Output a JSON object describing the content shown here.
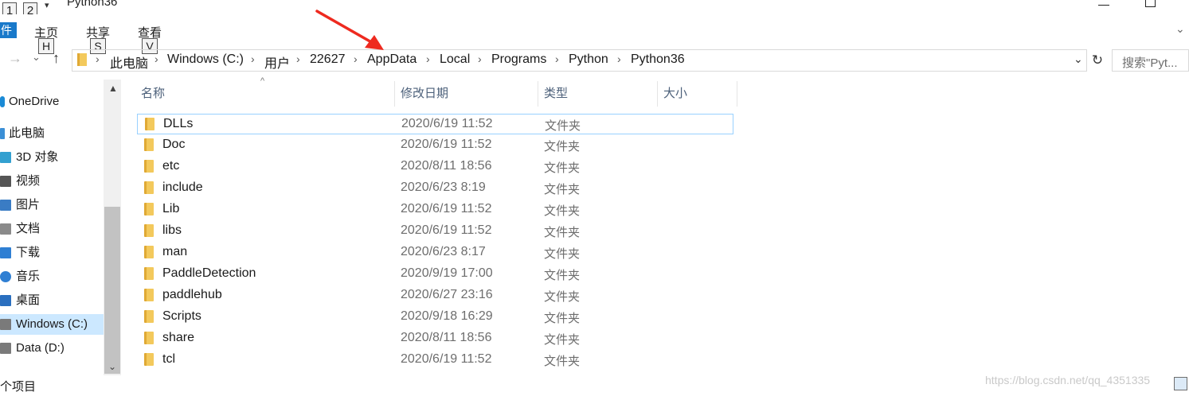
{
  "window": {
    "title": "Python36"
  },
  "quick_access": {
    "badges": [
      "1",
      "2"
    ],
    "dropdown_icon": "caret-down-icon"
  },
  "ribbon": {
    "file_tab_label": "件",
    "tabs": [
      {
        "label": "主页",
        "keytip": "H"
      },
      {
        "label": "共享",
        "keytip": "S"
      },
      {
        "label": "查看",
        "keytip": "V"
      }
    ]
  },
  "address": {
    "breadcrumbs": [
      "此电脑",
      "Windows (C:)",
      "用户",
      "22627",
      "AppData",
      "Local",
      "Programs",
      "Python",
      "Python36"
    ],
    "separator": "›"
  },
  "search": {
    "placeholder": "搜索\"Pyt..."
  },
  "nav_pane": {
    "items": [
      {
        "label": "OneDrive",
        "icon": "cloud-icon",
        "color": "#1a8ad6"
      },
      {
        "label": "此电脑",
        "icon": "computer-icon",
        "color": "#3b8fd6"
      },
      {
        "label": "3D 对象",
        "icon": "cube-icon",
        "color": "#33a0d0"
      },
      {
        "label": "视频",
        "icon": "film-icon",
        "color": "#555555"
      },
      {
        "label": "图片",
        "icon": "picture-icon",
        "color": "#3a7cc4"
      },
      {
        "label": "文档",
        "icon": "document-icon",
        "color": "#8a8a8a"
      },
      {
        "label": "下载",
        "icon": "download-arrow-icon",
        "color": "#2f7fd3"
      },
      {
        "label": "音乐",
        "icon": "music-note-icon",
        "color": "#2f7fd3"
      },
      {
        "label": "桌面",
        "icon": "desktop-icon",
        "color": "#2a6fbf"
      },
      {
        "label": "Windows (C:)",
        "icon": "drive-icon",
        "color": "#7a7a7a",
        "selected": true
      },
      {
        "label": "Data (D:)",
        "icon": "drive-icon",
        "color": "#7a7a7a"
      }
    ]
  },
  "columns": {
    "name": "名称",
    "date": "修改日期",
    "type": "类型",
    "size": "大小"
  },
  "files": [
    {
      "name": "DLLs",
      "date": "2020/6/19 11:52",
      "type": "文件夹"
    },
    {
      "name": "Doc",
      "date": "2020/6/19 11:52",
      "type": "文件夹"
    },
    {
      "name": "etc",
      "date": "2020/8/11 18:56",
      "type": "文件夹"
    },
    {
      "name": "include",
      "date": "2020/6/23 8:19",
      "type": "文件夹"
    },
    {
      "name": "Lib",
      "date": "2020/6/19 11:52",
      "type": "文件夹"
    },
    {
      "name": "libs",
      "date": "2020/6/19 11:52",
      "type": "文件夹"
    },
    {
      "name": "man",
      "date": "2020/6/23 8:17",
      "type": "文件夹"
    },
    {
      "name": "PaddleDetection",
      "date": "2020/9/19 17:00",
      "type": "文件夹"
    },
    {
      "name": "paddlehub",
      "date": "2020/6/27 23:16",
      "type": "文件夹"
    },
    {
      "name": "Scripts",
      "date": "2020/9/18 16:29",
      "type": "文件夹"
    },
    {
      "name": "share",
      "date": "2020/8/11 18:56",
      "type": "文件夹"
    },
    {
      "name": "tcl",
      "date": "2020/6/19 11:52",
      "type": "文件夹"
    }
  ],
  "status": {
    "text": "个项目"
  },
  "watermark": "https://blog.csdn.net/qq_4351335",
  "annotation": {
    "arrow_color": "#ee2a1f",
    "target": "AppData"
  }
}
